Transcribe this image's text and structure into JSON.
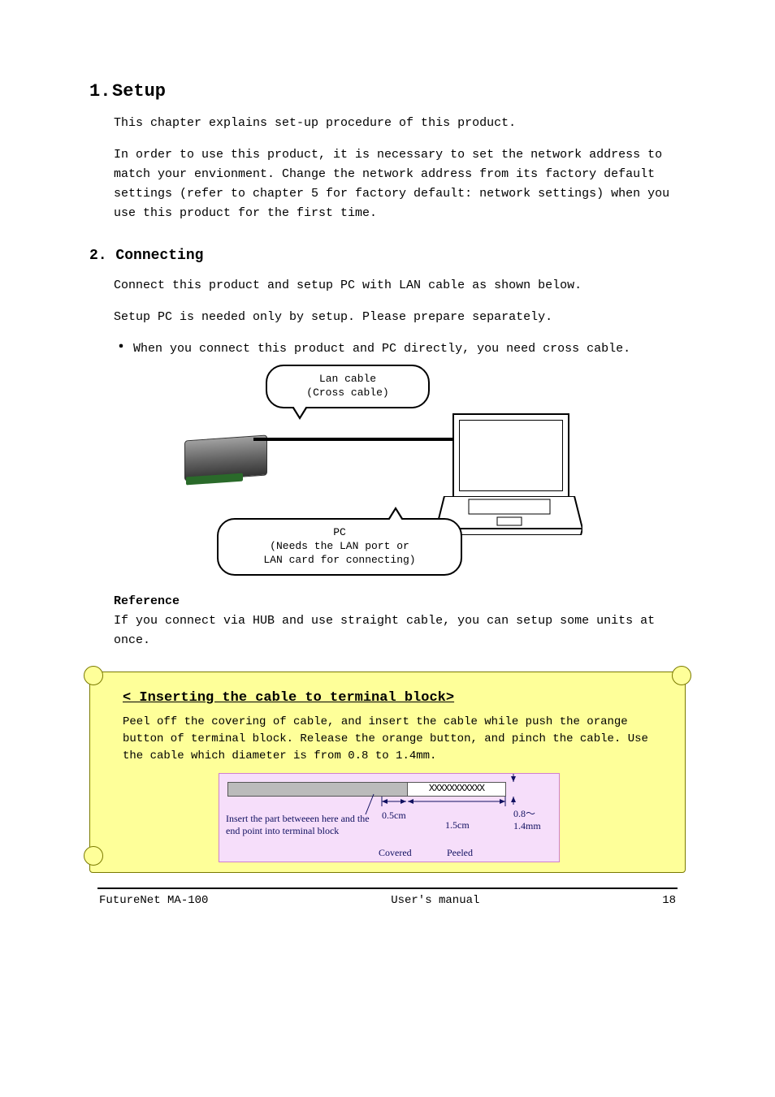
{
  "section": {
    "number": "1.",
    "title": "Setup",
    "intro1": "This chapter explains set-up procedure of this product.",
    "intro2": "In order to use this product, it is necessary to set the network address to match your envionment. Change the network address from its factory default settings (refer to chapter 5 for factory default: network settings) when you use this product for the first time."
  },
  "subsection": {
    "number": "2.",
    "title": "Connecting",
    "para1": "Connect this product and setup PC with LAN cable as shown below.",
    "para2": "Setup PC is needed only by setup. Please prepare separately.",
    "bullet": "When you connect this product and PC directly, you need cross cable."
  },
  "diagram": {
    "top_bubble": "Lan cable\n(Cross cable)",
    "bottom_bubble": "PC\n(Needs the LAN port or\nLAN card for connecting)"
  },
  "reference": {
    "label": "Reference",
    "text": "If you connect via HUB and use straight cable, you can setup some units at once."
  },
  "tip": {
    "heading": "< Inserting the cable to terminal block>",
    "text": "Peel off the covering of cable, and insert the cable while push the orange button of terminal block. Release the orange button, and pinch the cable. Use the cable which diameter is from 0.8 to 1.4mm.",
    "fig": {
      "insert_text": "Insert the part betweeen here and the end point into terminal block",
      "covered_05": "0.5cm",
      "covered_label": "Covered",
      "peeled_15": "1.5cm",
      "peeled_label": "Peeled",
      "dia_range": "0.8～1.4mm"
    }
  },
  "footer": {
    "left": "FutureNet MA-100",
    "center": "User's manual",
    "right": "18"
  }
}
